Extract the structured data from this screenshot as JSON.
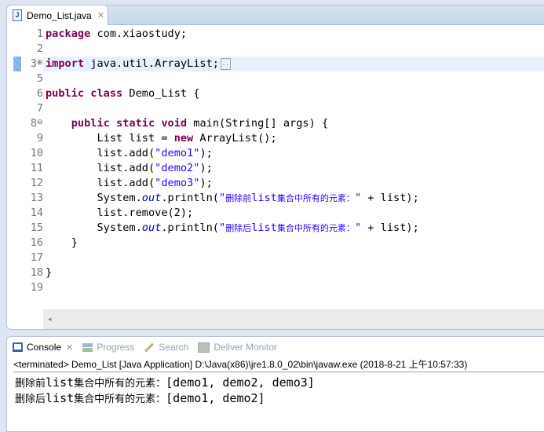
{
  "editor": {
    "tab": {
      "label": "Demo_List.java",
      "icon": "java-file-icon",
      "close_glyph": "✕"
    },
    "lines": [
      {
        "n": "1",
        "segments": [
          {
            "t": "package",
            "c": "kw"
          },
          {
            "t": " com.xiaostudy;",
            "c": ""
          }
        ]
      },
      {
        "n": "2",
        "segments": []
      },
      {
        "n": "3",
        "fold": "expand",
        "highlighted": true,
        "segments": [
          {
            "t": "import",
            "c": "kw"
          },
          {
            "t": " java.util.ArrayList;",
            "c": ""
          }
        ],
        "folded_marker": ".."
      },
      {
        "n": "5",
        "segments": []
      },
      {
        "n": "6",
        "segments": [
          {
            "t": "public",
            "c": "kw"
          },
          {
            "t": " ",
            "c": ""
          },
          {
            "t": "class",
            "c": "kw"
          },
          {
            "t": " Demo_List {",
            "c": ""
          }
        ]
      },
      {
        "n": "7",
        "segments": []
      },
      {
        "n": "8",
        "fold": "collapse",
        "segments": [
          {
            "t": "    ",
            "c": ""
          },
          {
            "t": "public",
            "c": "kw"
          },
          {
            "t": " ",
            "c": ""
          },
          {
            "t": "static",
            "c": "kw"
          },
          {
            "t": " ",
            "c": ""
          },
          {
            "t": "void",
            "c": "kw"
          },
          {
            "t": " main(String[] args) {",
            "c": ""
          }
        ]
      },
      {
        "n": "9",
        "segments": [
          {
            "t": "        List list = ",
            "c": ""
          },
          {
            "t": "new",
            "c": "kw"
          },
          {
            "t": " ArrayList();",
            "c": ""
          }
        ]
      },
      {
        "n": "10",
        "segments": [
          {
            "t": "        list.add(",
            "c": ""
          },
          {
            "t": "\"demo1\"",
            "c": "str"
          },
          {
            "t": ");",
            "c": ""
          }
        ]
      },
      {
        "n": "11",
        "segments": [
          {
            "t": "        list.add(",
            "c": ""
          },
          {
            "t": "\"demo2\"",
            "c": "str"
          },
          {
            "t": ");",
            "c": ""
          }
        ]
      },
      {
        "n": "12",
        "segments": [
          {
            "t": "        list.add(",
            "c": ""
          },
          {
            "t": "\"demo3\"",
            "c": "str"
          },
          {
            "t": ");",
            "c": ""
          }
        ]
      },
      {
        "n": "13",
        "segments": [
          {
            "t": "        System.",
            "c": ""
          },
          {
            "t": "out",
            "c": "fld"
          },
          {
            "t": ".println(",
            "c": ""
          },
          {
            "t": "\"",
            "c": "str"
          },
          {
            "t": "删除前",
            "c": "str cn"
          },
          {
            "t": "list",
            "c": "str"
          },
          {
            "t": "集合中所有的元素：",
            "c": "str cn"
          },
          {
            "t": "\"",
            "c": "str"
          },
          {
            "t": " + list);",
            "c": ""
          }
        ]
      },
      {
        "n": "14",
        "segments": [
          {
            "t": "        list.remove(2);",
            "c": ""
          }
        ]
      },
      {
        "n": "15",
        "segments": [
          {
            "t": "        System.",
            "c": ""
          },
          {
            "t": "out",
            "c": "fld"
          },
          {
            "t": ".println(",
            "c": ""
          },
          {
            "t": "\"",
            "c": "str"
          },
          {
            "t": "删除后",
            "c": "str cn"
          },
          {
            "t": "list",
            "c": "str"
          },
          {
            "t": "集合中所有的元素：",
            "c": "str cn"
          },
          {
            "t": "\"",
            "c": "str"
          },
          {
            "t": " + list);",
            "c": ""
          }
        ]
      },
      {
        "n": "16",
        "segments": [
          {
            "t": "    }",
            "c": ""
          }
        ]
      },
      {
        "n": "17",
        "segments": []
      },
      {
        "n": "18",
        "segments": [
          {
            "t": "}",
            "c": ""
          }
        ]
      },
      {
        "n": "19",
        "segments": []
      }
    ],
    "hscroll_arrow": "◂"
  },
  "console": {
    "tabs": [
      {
        "label": "Console",
        "icon": "console-icon",
        "active": true,
        "close_glyph": "✕"
      },
      {
        "label": "Progress",
        "icon": "progress-icon",
        "active": false
      },
      {
        "label": "Search",
        "icon": "search-icon",
        "active": false
      },
      {
        "label": "Deliver Monitor",
        "icon": "deliver-monitor-icon",
        "active": false
      }
    ],
    "status": "<terminated> Demo_List [Java Application] D:\\Java(x86)\\jre1.8.0_02\\bin\\javaw.exe (2018-8-21 上午10:57:33)",
    "output": [
      {
        "prefix": "删除前",
        "mid": "list",
        "suffix": "集合中所有的元素：",
        "value": "[demo1, demo2, demo3]"
      },
      {
        "prefix": "删除后",
        "mid": "list",
        "suffix": "集合中所有的元素：",
        "value": "[demo1, demo2]"
      }
    ]
  }
}
